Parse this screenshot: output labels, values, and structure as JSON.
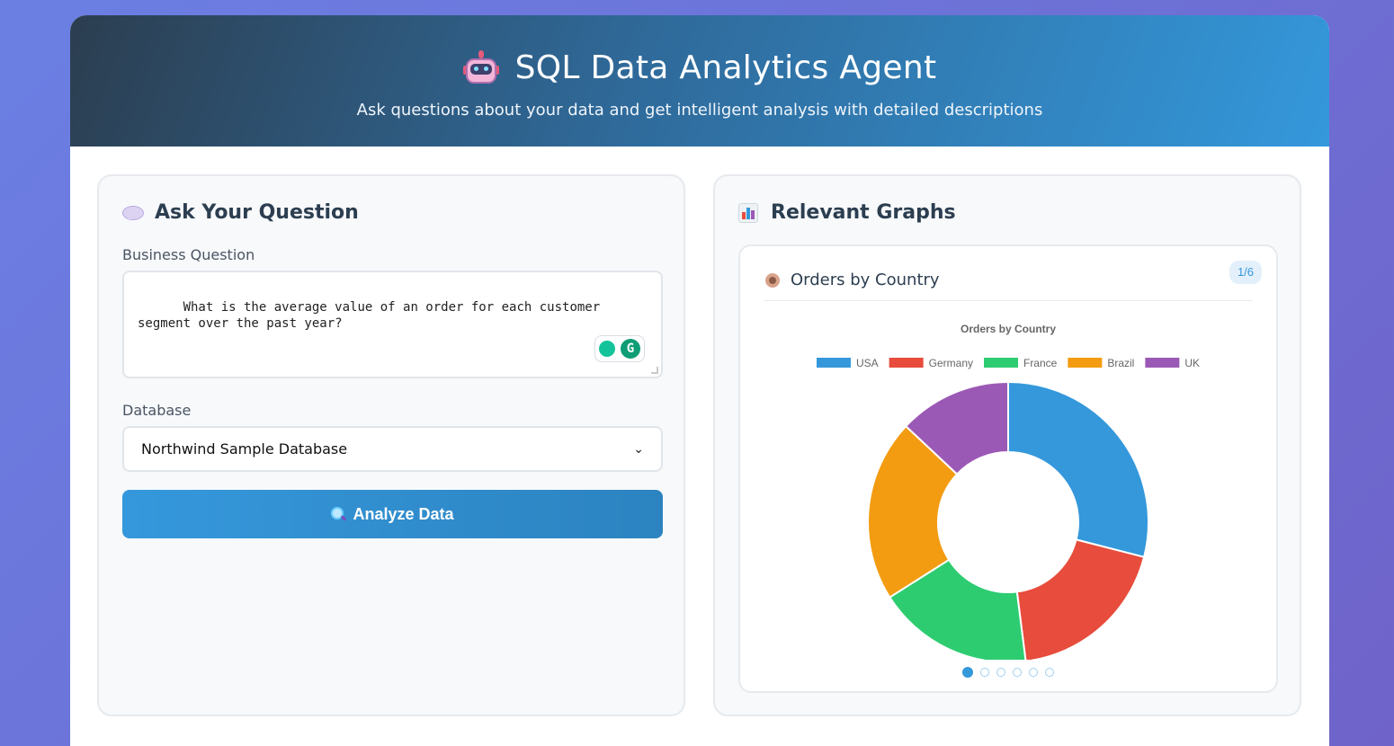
{
  "header": {
    "title": "SQL Data Analytics Agent",
    "subtitle": "Ask questions about your data and get intelligent analysis with detailed descriptions"
  },
  "question_panel": {
    "title": "Ask Your Question",
    "question_label": "Business Question",
    "question_value": "What is the average value of an order for each customer\nsegment over the past year?",
    "database_label": "Database",
    "database_selected": "Northwind Sample Database",
    "analyze_button": "Analyze Data",
    "grammarly_letter": "G"
  },
  "graphs_panel": {
    "title": "Relevant Graphs",
    "card_title": "Orders by Country",
    "page_indicator": "1/6",
    "pages": 6,
    "active_page": 1
  },
  "colors": {
    "accent": "#3498db",
    "header_dark": "#2c3e50"
  },
  "chart_data": {
    "type": "pie",
    "title": "Orders by Country",
    "categories": [
      "USA",
      "Germany",
      "France",
      "Brazil",
      "UK"
    ],
    "values": [
      29,
      19,
      18,
      21,
      13
    ],
    "colors": [
      "#3498db",
      "#e74c3c",
      "#2ecc71",
      "#f39c12",
      "#9b59b6"
    ],
    "donut": true,
    "legend": "top"
  }
}
